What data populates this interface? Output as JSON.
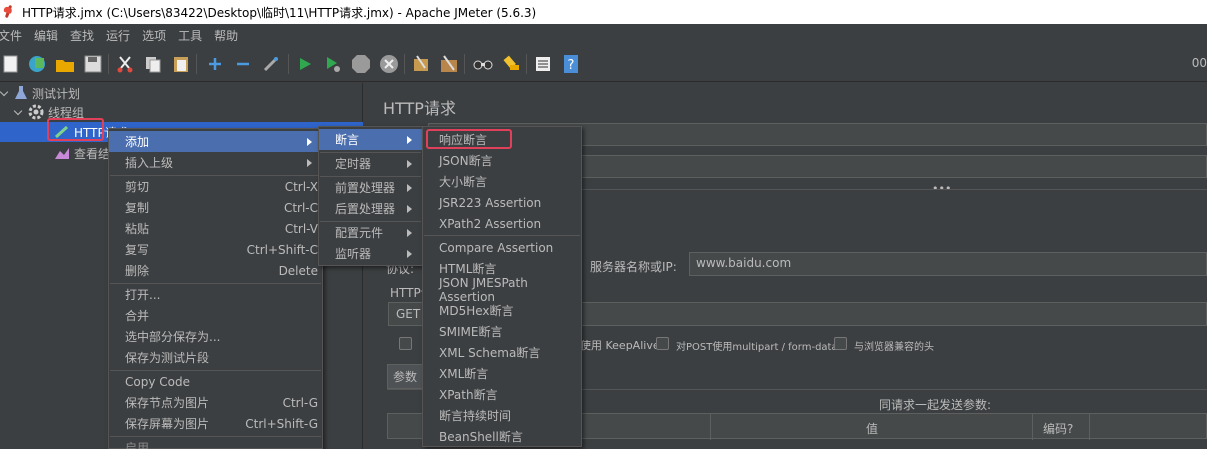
{
  "window": {
    "title": "HTTP请求.jmx (C:\\Users\\83422\\Desktop\\临时\\11\\HTTP请求.jmx) - Apache JMeter (5.6.3)"
  },
  "menubar": [
    "文件",
    "编辑",
    "查找",
    "运行",
    "选项",
    "工具",
    "帮助"
  ],
  "toolbar": {
    "right_text": "00"
  },
  "tree": {
    "test_plan": "测试计划",
    "thread_group": "线程组",
    "http_request": "HTTP请求",
    "view_results": "查看结"
  },
  "panel": {
    "title": "HTTP请求",
    "server_label": "服务器名称或IP:",
    "server_value": "www.baidu.com",
    "protocol_label": "协议:",
    "http_label": "HTTP请",
    "method_value": "GET",
    "keepalive": "使用 KeepAlive",
    "multipart": "对POST使用multipart / form-data",
    "browser_headers": "与浏览器兼容的头",
    "params_tab": "参数",
    "send_params": "同请求一起发送参数:",
    "col_value": "值",
    "col_encode": "编码?"
  },
  "context_menu": {
    "items": [
      {
        "label": "添加",
        "submenu": true
      },
      {
        "label": "插入上级",
        "submenu": true
      },
      {
        "label": "剪切",
        "shortcut": "Ctrl-X"
      },
      {
        "label": "复制",
        "shortcut": "Ctrl-C"
      },
      {
        "label": "粘贴",
        "shortcut": "Ctrl-V"
      },
      {
        "label": "复写",
        "shortcut": "Ctrl+Shift-C"
      },
      {
        "label": "删除",
        "shortcut": "Delete"
      },
      {
        "label": "打开..."
      },
      {
        "label": "合并"
      },
      {
        "label": "选中部分保存为..."
      },
      {
        "label": "保存为测试片段"
      },
      {
        "label": "Copy Code"
      },
      {
        "label": "保存节点为图片",
        "shortcut": "Ctrl-G"
      },
      {
        "label": "保存屏幕为图片",
        "shortcut": "Ctrl+Shift-G"
      },
      {
        "label": "启用"
      }
    ]
  },
  "add_submenu": {
    "items": [
      {
        "label": "断言"
      },
      {
        "label": "定时器"
      },
      {
        "label": "前置处理器"
      },
      {
        "label": "后置处理器"
      },
      {
        "label": "配置元件"
      },
      {
        "label": "监听器"
      }
    ]
  },
  "assertion_submenu": {
    "items": [
      "响应断言",
      "JSON断言",
      "大小断言",
      "JSR223 Assertion",
      "XPath2 Assertion",
      "Compare Assertion",
      "HTML断言",
      "JSON JMESPath Assertion",
      "MD5Hex断言",
      "SMIME断言",
      "XML Schema断言",
      "XML断言",
      "XPath断言",
      "断言持续时间",
      "BeanShell断言"
    ]
  },
  "colors": {
    "selection": "#2f65ca",
    "menu_highlight": "#4b6eaf",
    "highlight_box": "#e0405a",
    "background": "#3c3f41"
  }
}
